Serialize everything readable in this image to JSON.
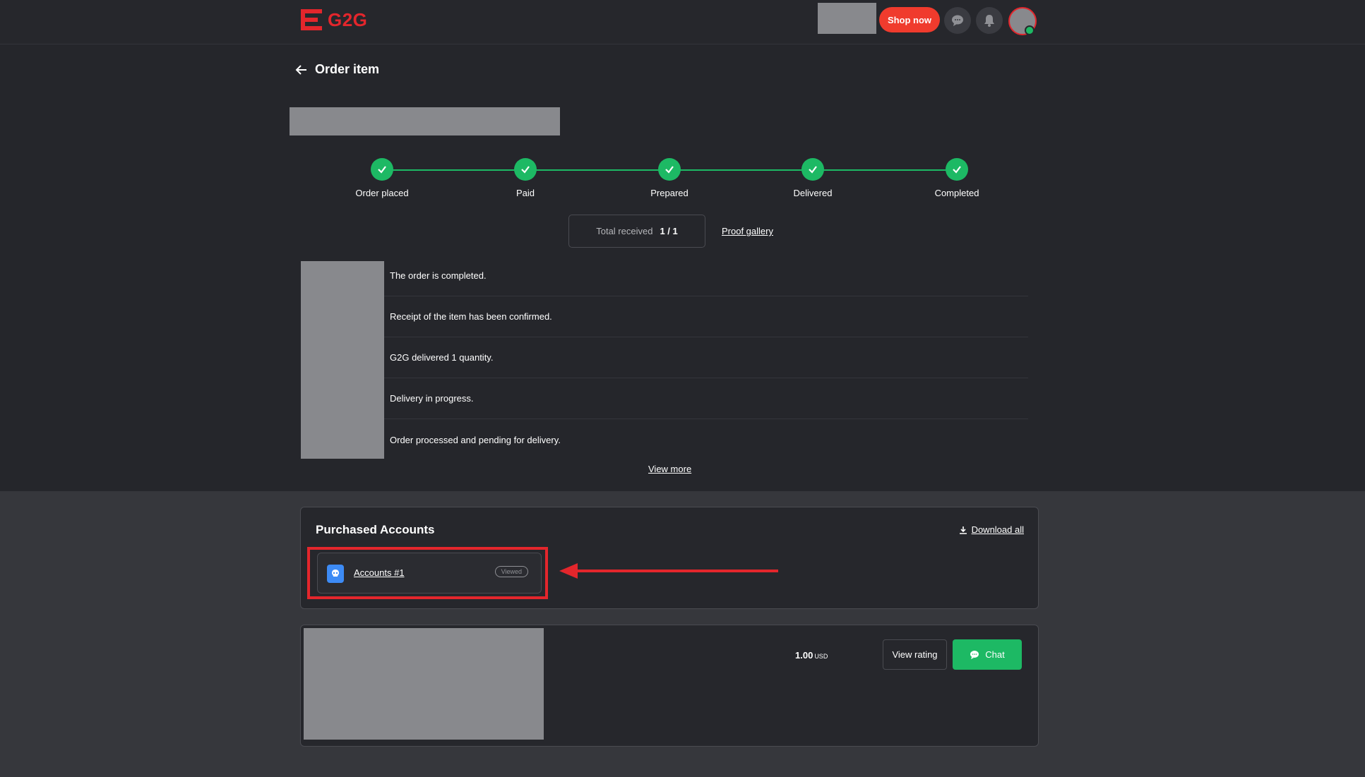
{
  "header": {
    "logo_text": "G2G",
    "shop_label": "Shop now",
    "icons": [
      "chat-bubble-icon",
      "bell-icon"
    ],
    "brand_color": "#e3262c",
    "accent_color": "#f03b2d"
  },
  "page": {
    "title": "Order item"
  },
  "stepper": {
    "steps": [
      "Order placed",
      "Paid",
      "Prepared",
      "Delivered",
      "Completed"
    ],
    "status": "all complete",
    "color": "#1db964"
  },
  "summary": {
    "total_received_label": "Total received",
    "total_received_value": "1 / 1",
    "proof_gallery": "Proof gallery"
  },
  "timeline": {
    "events": [
      "The order is completed.",
      "Receipt of the item has been confirmed.",
      "G2G delivered 1 quantity.",
      "Delivery in progress.",
      "Order processed and pending for delivery."
    ],
    "view_more": "View more"
  },
  "purchased": {
    "title": "Purchased Accounts",
    "download_all": "Download all",
    "items": [
      {
        "label": "Accounts #1",
        "badge": "Viewed"
      }
    ],
    "highlight_color": "#e3262c"
  },
  "offer": {
    "price": "1.00",
    "currency": "USD",
    "view_rating": "View rating",
    "chat": "Chat"
  }
}
